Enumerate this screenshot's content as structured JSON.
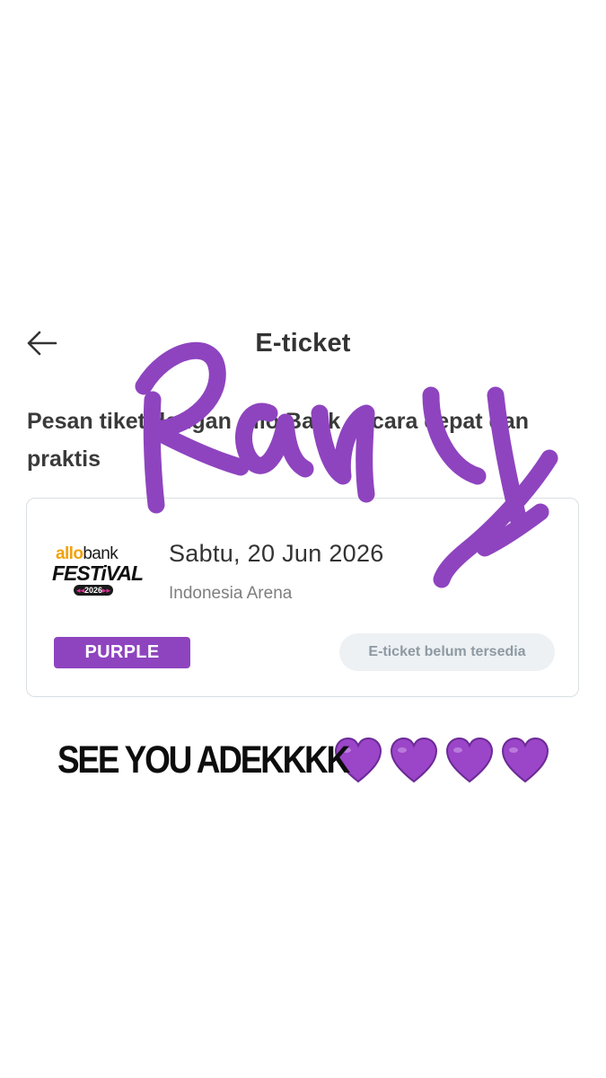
{
  "header": {
    "title": "E-ticket",
    "back_icon": "arrow-left-icon"
  },
  "promo": {
    "text": "Pesan tiket dengan Allo Bank secara cepat dan praktis"
  },
  "ticket": {
    "logo": {
      "brand_primary": "allo",
      "brand_secondary": "bank",
      "event_name": "FESTiVAL",
      "year": "2026",
      "year_left_marks": "◂◂",
      "year_right_marks": "▸▸"
    },
    "date": "Sabtu, 20 Jun 2026",
    "venue": "Indonesia Arena",
    "category": "PURPLE",
    "status": "E-ticket belum tersedia"
  },
  "caption": {
    "text": "SEE YOU ADEKKKK",
    "heart_count": 4,
    "heart_icon": "purple-heart-icon"
  },
  "overlay": {
    "signature_color": "#8e44bf",
    "signature_word": "Rara"
  },
  "colors": {
    "accent_purple": "#8e44bf",
    "status_gray": "#edf1f4",
    "logo_orange": "#f2a20c"
  }
}
